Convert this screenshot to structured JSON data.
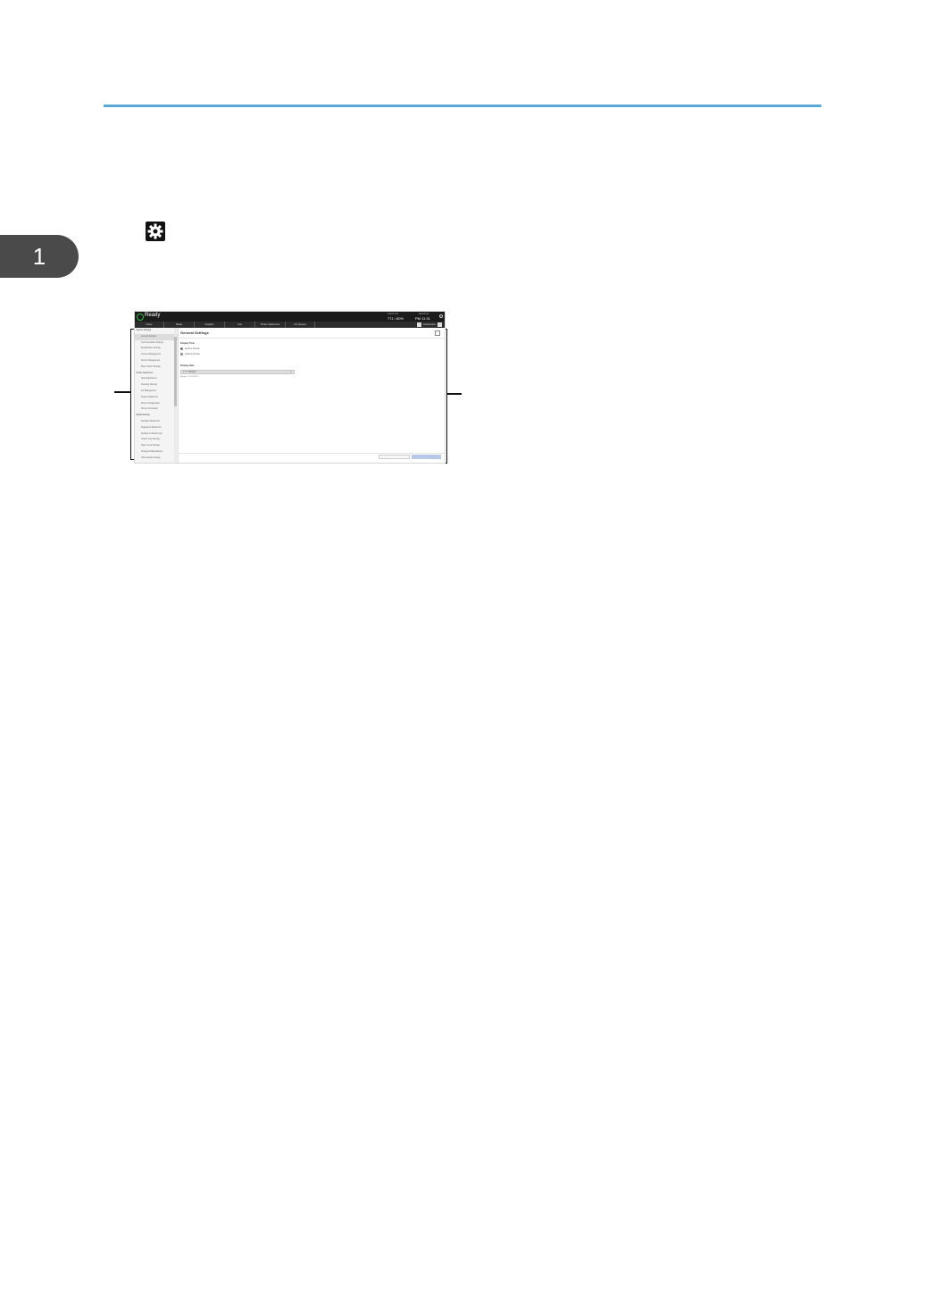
{
  "chapter_tab": "1",
  "screenshot": {
    "status": "Ready",
    "meta": [
      {
        "label": "Imprint Cnt",
        "value": "771 / 60%"
      },
      {
        "label": "Date/Time",
        "value": "PM 11:31"
      }
    ],
    "nav_tabs": [
      "Home",
      "Media",
      "Supplies",
      "Test",
      "Printer Adjustment",
      "Job Queues"
    ],
    "user_label": "Administrator",
    "sidebar_items": [
      {
        "label": "System Settings",
        "level": "group"
      },
      {
        "label": "General Settings",
        "level": "sub",
        "selected": true
      },
      {
        "label": "Communication Settings",
        "level": "sub"
      },
      {
        "label": "Email/Folder Settings",
        "level": "sub"
      },
      {
        "label": "License Management",
        "level": "sub"
      },
      {
        "label": "Device Management",
        "level": "sub"
      },
      {
        "label": "Web Control Settings",
        "level": "sub"
      },
      {
        "label": "Printer Adjustment",
        "level": "group"
      },
      {
        "label": "Head Adjustment",
        "level": "sub"
      },
      {
        "label": "Cleaning Settings",
        "level": "sub"
      },
      {
        "label": "Ink Management",
        "level": "sub"
      },
      {
        "label": "Output Adjustment",
        "level": "sub"
      },
      {
        "label": "Printer Configuration",
        "level": "sub"
      },
      {
        "label": "Printer Information",
        "level": "sub"
      },
      {
        "label": "Media Settings",
        "level": "group"
      },
      {
        "label": "Standard Media Info",
        "level": "sub"
      },
      {
        "label": "Registered Media Info",
        "level": "sub"
      },
      {
        "label": "Settings for Media Type",
        "level": "sub"
      },
      {
        "label": "Output Tray Settings",
        "level": "sub"
      },
      {
        "label": "Paper Feed Settings",
        "level": "sub"
      },
      {
        "label": "Change Media Settings",
        "level": "sub"
      },
      {
        "label": "Other Media Settings",
        "level": "sub"
      }
    ],
    "main": {
      "title": "General Settings",
      "section1_label": "Display Time",
      "radio_options": [
        {
          "label": "12-hour Format",
          "checked": true
        },
        {
          "label": "24-hour Format",
          "checked": false
        }
      ],
      "section2_label": "Display Date",
      "select_value": "YYYY/MM/DD",
      "hint": "Sample : 2017/01/31"
    }
  }
}
